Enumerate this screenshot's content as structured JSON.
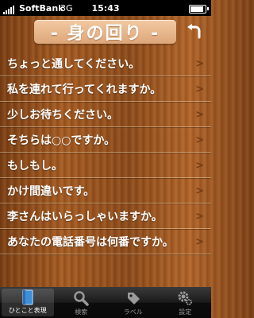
{
  "status_bar": {
    "carrier": "SoftBank",
    "network": "3G",
    "time": "15:43"
  },
  "header": {
    "title": "- 身の回り -",
    "back_icon": "back-arrow-icon"
  },
  "phrases": [
    "ちょっと通してください。",
    "私を連れて行ってくれますか。",
    "少しお待ちください。",
    "そちらは○○ですか。",
    "もしもし。",
    "かけ間違いです。",
    "李さんはいらっしゃいますか。",
    "あなたの電話番号は何番ですか。"
  ],
  "tabs": [
    {
      "label": "ひとこと表現",
      "icon": "book-icon",
      "active": true
    },
    {
      "label": "検索",
      "icon": "search-icon",
      "active": false
    },
    {
      "label": "ラベル",
      "icon": "tag-icon",
      "active": false
    },
    {
      "label": "設定",
      "icon": "gear-icon",
      "active": false
    }
  ],
  "colors": {
    "title_badge": "#e8b88c",
    "text": "#ffffff",
    "chevron": "#6b3510"
  }
}
